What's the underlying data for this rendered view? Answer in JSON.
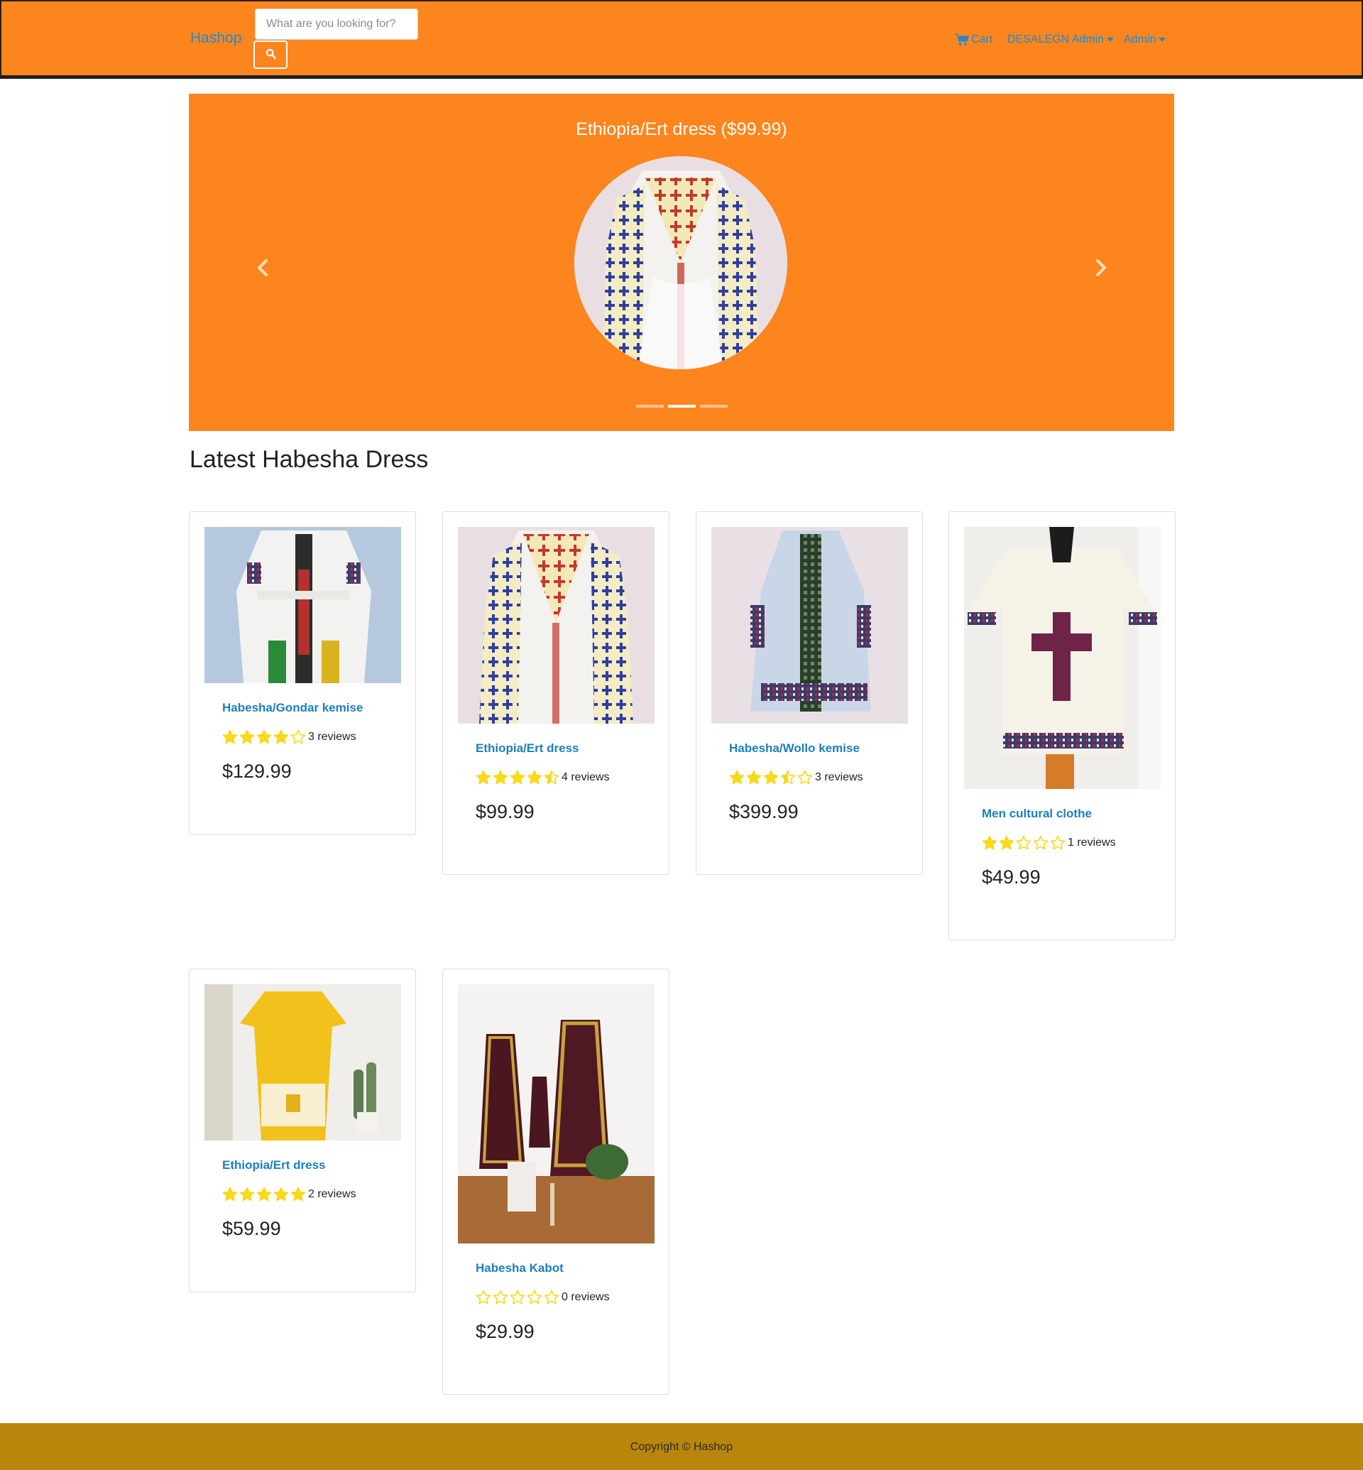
{
  "navbar": {
    "brand": "Hashop",
    "search_placeholder": "What are you looking for?",
    "cart_label": "Cart",
    "user_label": "DESALEGN Admin",
    "admin_label": "Admin",
    "icons": {
      "search": "search-icon",
      "cart": "cart-icon",
      "caret": "caret-down-icon"
    },
    "colors": {
      "background": "#fd851e",
      "link": "#1f8ad0"
    }
  },
  "carousel": {
    "caption": "Ethiopia/Ert dress ($99.99)",
    "slide_count": 3,
    "active_slide": 2,
    "icons": {
      "prev": "chevron-left-icon",
      "next": "chevron-right-icon"
    }
  },
  "section": {
    "title": "Latest Habesha Dress"
  },
  "products": [
    {
      "title": "Habesha/Gondar kemise",
      "rating": 4,
      "reviews": "3 reviews",
      "price": "$129.99"
    },
    {
      "title": "Ethiopia/Ert dress",
      "rating": 4.5,
      "reviews": "4 reviews",
      "price": "$99.99"
    },
    {
      "title": "Habesha/Wollo kemise",
      "rating": 3.5,
      "reviews": "3 reviews",
      "price": "$399.99"
    },
    {
      "title": "Men cultural clothe",
      "rating": 2,
      "reviews": "1 reviews",
      "price": "$49.99"
    },
    {
      "title": "Ethiopia/Ert dress",
      "rating": 5,
      "reviews": "2 reviews",
      "price": "$59.99"
    },
    {
      "title": "Habesha Kabot",
      "rating": 0,
      "reviews": "0 reviews",
      "price": "$29.99"
    }
  ],
  "rating_colors": {
    "star": "#f8d91b"
  },
  "footer": {
    "text": "Copyright © Hashop",
    "background": "#b8860b"
  }
}
